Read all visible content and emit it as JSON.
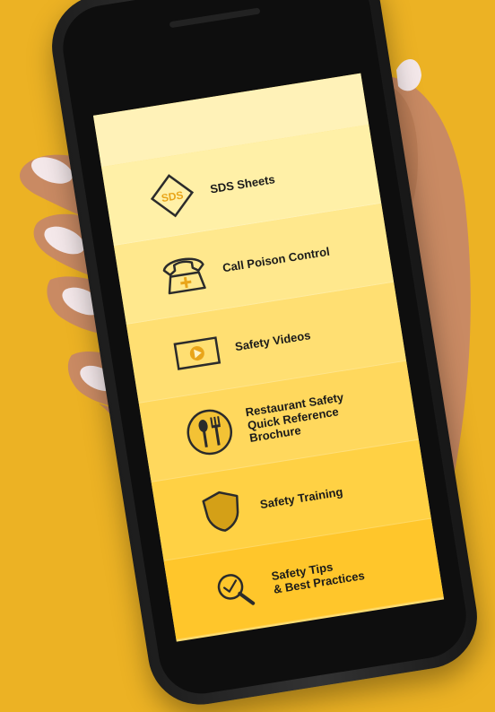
{
  "menu": {
    "items": [
      {
        "label": "SDS Sheets",
        "icon": "sds-diamond-icon",
        "icon_text": "SDS"
      },
      {
        "label": "Call Poison Control",
        "icon": "telephone-icon"
      },
      {
        "label": "Safety Videos",
        "icon": "video-play-icon"
      },
      {
        "label": "Restaurant Safety\nQuick Reference\nBrochure",
        "icon": "fork-spoon-icon"
      },
      {
        "label": "Safety Training",
        "icon": "shield-icon"
      },
      {
        "label": "Safety Tips\n& Best Practices",
        "icon": "magnifier-check-icon"
      }
    ]
  },
  "colors": {
    "background": "#ecb224",
    "accent": "#f0b52a",
    "icon_stroke": "#2b2b2b"
  }
}
